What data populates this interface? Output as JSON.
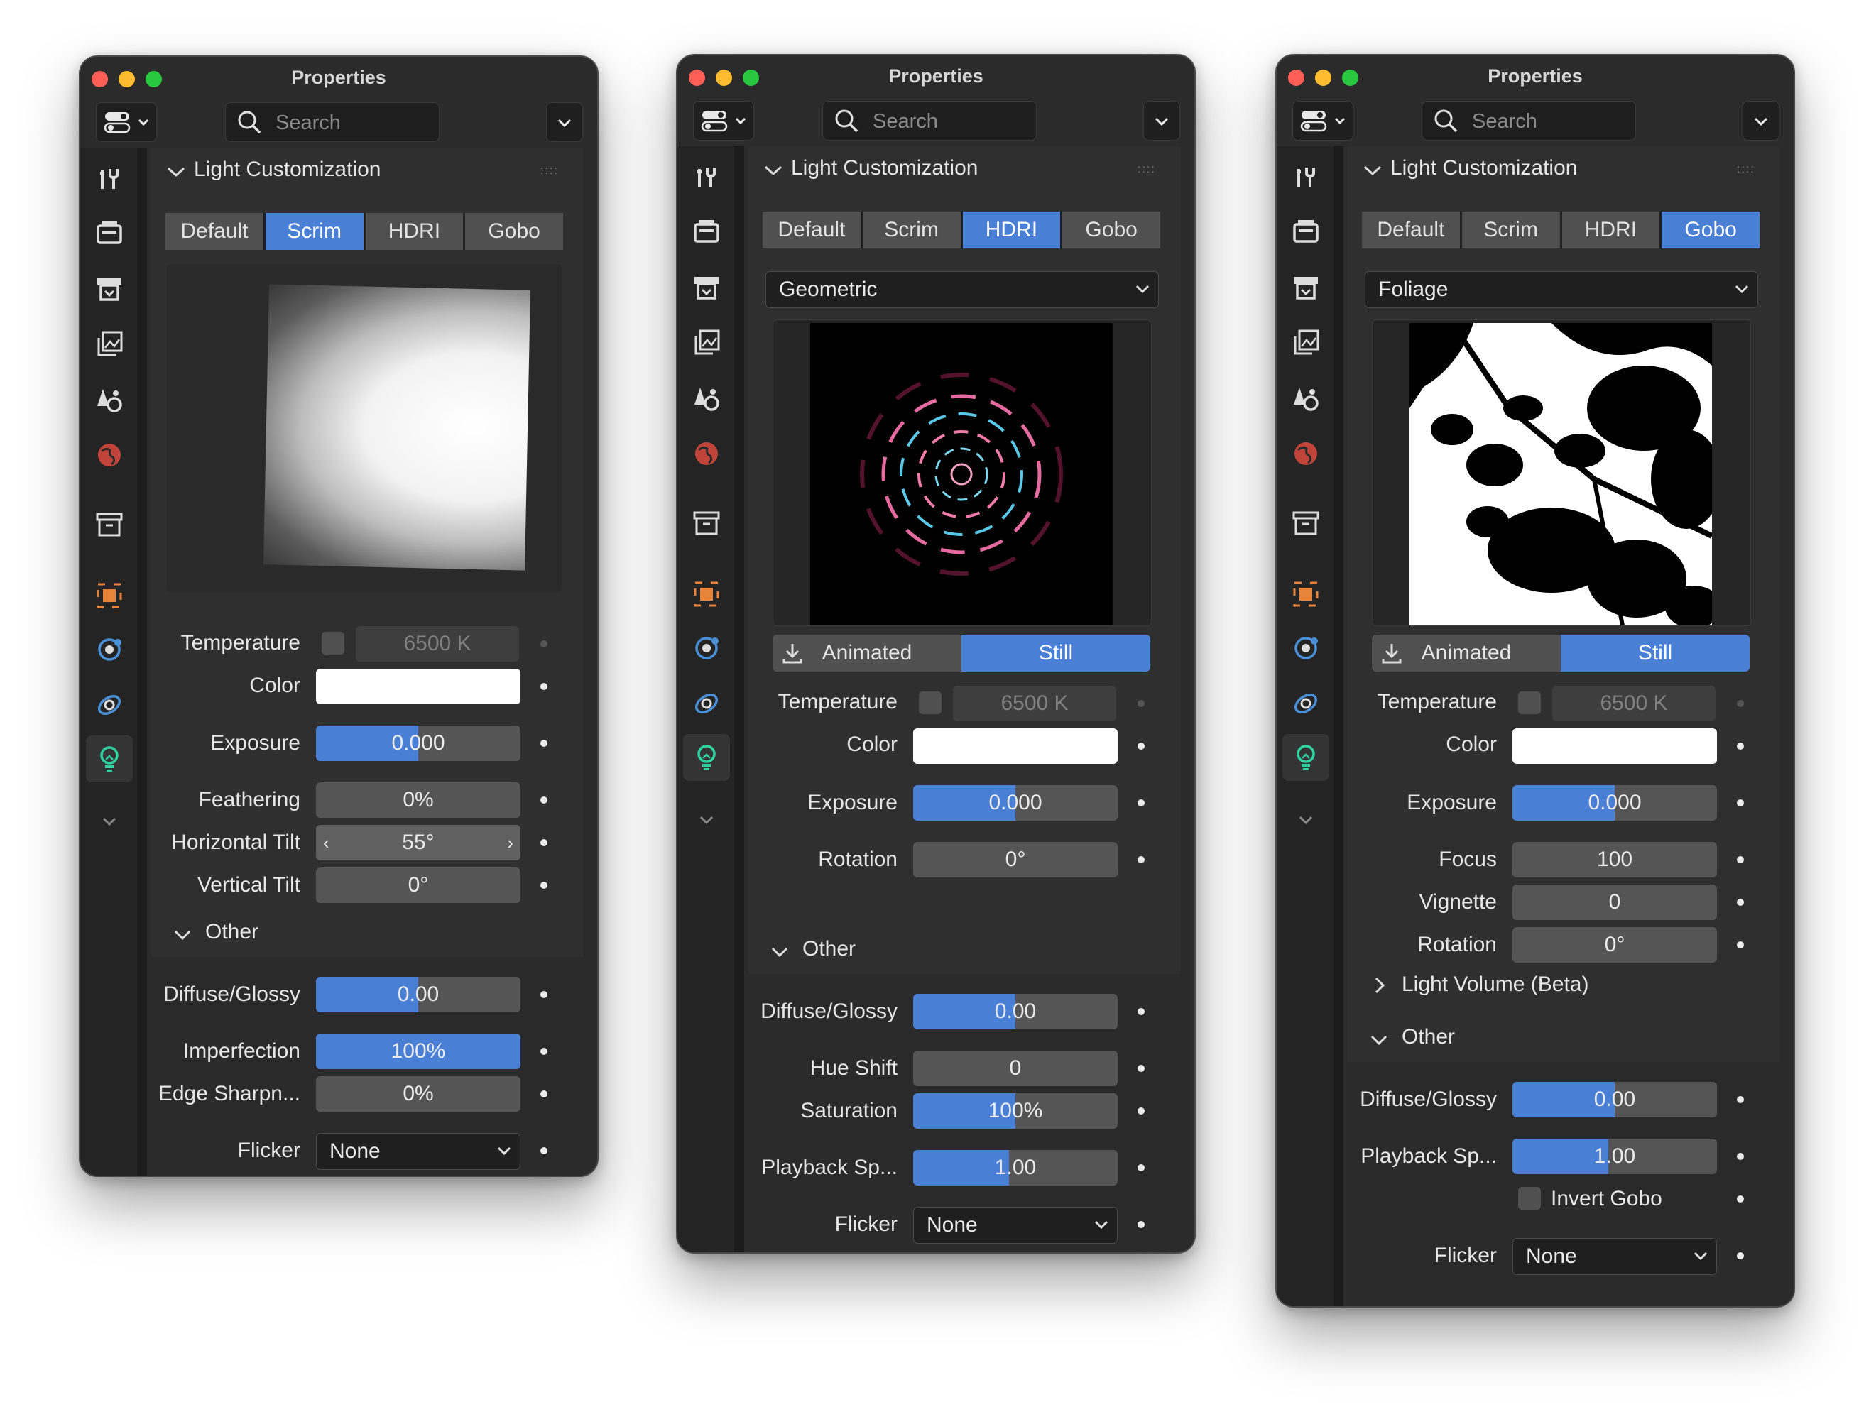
{
  "window_title": "Properties",
  "search_placeholder": "Search",
  "section_title": "Light Customization",
  "tabs": [
    "Default",
    "Scrim",
    "HDRI",
    "Gobo"
  ],
  "panel1": {
    "active_tab": "Scrim",
    "temperature_label": "Temperature",
    "temperature_value": "6500 K",
    "color_label": "Color",
    "exposure_label": "Exposure",
    "exposure_value": "0.000",
    "exposure_fill": 0.5,
    "feathering_label": "Feathering",
    "feathering_value": "0%",
    "htilt_label": "Horizontal Tilt",
    "htilt_value": "55°",
    "vtilt_label": "Vertical Tilt",
    "vtilt_value": "0°",
    "other_label": "Other",
    "diffuse_label": "Diffuse/Glossy",
    "diffuse_value": "0.00",
    "diffuse_fill": 0.5,
    "imperfection_label": "Imperfection",
    "imperfection_value": "100%",
    "imperfection_fill": 1.0,
    "edge_label": "Edge Sharpn...",
    "edge_value": "0%",
    "flicker_label": "Flicker",
    "flicker_value": "None"
  },
  "panel2": {
    "active_tab": "HDRI",
    "preset_value": "Geometric",
    "animated_label": "Animated",
    "still_label": "Still",
    "temperature_label": "Temperature",
    "temperature_value": "6500 K",
    "color_label": "Color",
    "exposure_label": "Exposure",
    "exposure_value": "0.000",
    "exposure_fill": 0.5,
    "rotation_label": "Rotation",
    "rotation_value": "0°",
    "other_label": "Other",
    "diffuse_label": "Diffuse/Glossy",
    "diffuse_value": "0.00",
    "diffuse_fill": 0.5,
    "hue_label": "Hue Shift",
    "hue_value": "0",
    "saturation_label": "Saturation",
    "saturation_value": "100%",
    "saturation_fill": 0.5,
    "playback_label": "Playback Sp...",
    "playback_value": "1.00",
    "playback_fill": 0.47,
    "flicker_label": "Flicker",
    "flicker_value": "None"
  },
  "panel3": {
    "active_tab": "Gobo",
    "preset_value": "Foliage",
    "animated_label": "Animated",
    "still_label": "Still",
    "temperature_label": "Temperature",
    "temperature_value": "6500 K",
    "color_label": "Color",
    "exposure_label": "Exposure",
    "exposure_value": "0.000",
    "exposure_fill": 0.5,
    "focus_label": "Focus",
    "focus_value": "100",
    "vignette_label": "Vignette",
    "vignette_value": "0",
    "rotation_label": "Rotation",
    "rotation_value": "0°",
    "light_volume_label": "Light Volume (Beta)",
    "other_label": "Other",
    "diffuse_label": "Diffuse/Glossy",
    "diffuse_value": "0.00",
    "diffuse_fill": 0.5,
    "playback_label": "Playback Sp...",
    "playback_value": "1.00",
    "playback_fill": 0.47,
    "invert_label": "Invert Gobo",
    "flicker_label": "Flicker",
    "flicker_value": "None"
  },
  "colors": {
    "accent": "#4a7fd6",
    "panel": "#2f2f2f",
    "window": "#2b2b2b"
  },
  "icons": [
    "sliders-view-icon",
    "search-icon",
    "chevron-down-icon",
    "tools-icon",
    "render-icon",
    "output-icon",
    "view-layer-icon",
    "scene-icon",
    "world-icon",
    "collection-icon",
    "object-icon",
    "physics-icon",
    "constraints-icon",
    "light-bulb-icon",
    "download-icon"
  ]
}
